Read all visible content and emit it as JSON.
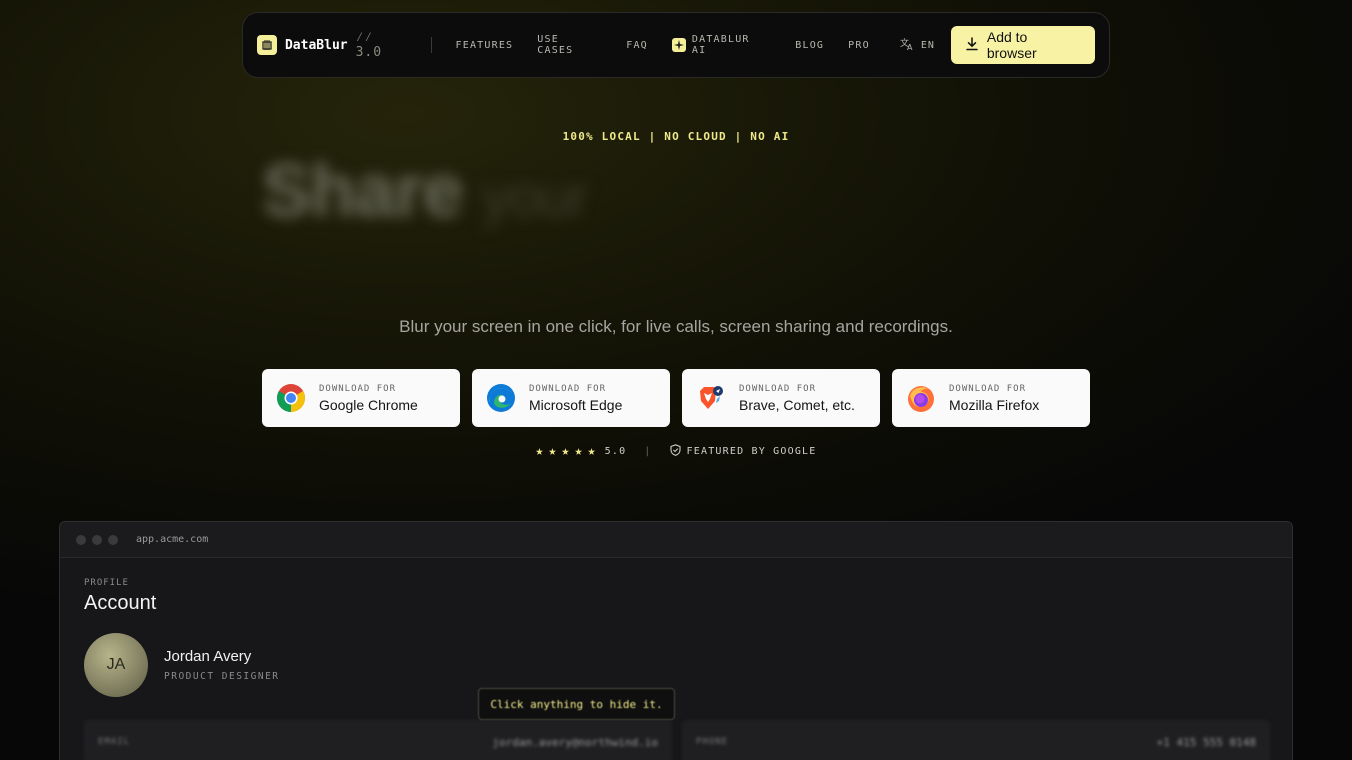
{
  "nav": {
    "brand": "DataBlur",
    "version": "⁄⁄ 3.0",
    "links": [
      {
        "label": "FEATURES"
      },
      {
        "label": "USE CASES"
      },
      {
        "label": "FAQ"
      },
      {
        "label": "DATABLUR AI"
      },
      {
        "label": "BLOG"
      },
      {
        "label": "PRO"
      }
    ],
    "language": "EN",
    "cta": "Add to browser"
  },
  "hero": {
    "tagline": "100% LOCAL | NO CLOUD | NO AI",
    "title_main": "Share",
    "title_rest": "your",
    "subtitle": "Blur your screen in one click, for live calls, screen sharing and recordings."
  },
  "downloads": [
    {
      "pre": "DOWNLOAD FOR",
      "name": "Google Chrome",
      "icon": "chrome-icon"
    },
    {
      "pre": "DOWNLOAD FOR",
      "name": "Microsoft Edge",
      "icon": "edge-icon"
    },
    {
      "pre": "DOWNLOAD FOR",
      "name": "Brave, Comet, etc.",
      "icon": "brave-icon"
    },
    {
      "pre": "DOWNLOAD FOR",
      "name": "Mozilla Firefox",
      "icon": "firefox-icon"
    }
  ],
  "rating": {
    "stars": 5,
    "score": "5.0",
    "featured": "FEATURED BY GOOGLE"
  },
  "mock": {
    "url": "app.acme.com",
    "section_label": "PROFILE",
    "title": "Account",
    "avatar_initials": "JA",
    "name": "Jordan Avery",
    "role": "PRODUCT DESIGNER",
    "fields": [
      {
        "label": "EMAIL",
        "value": "jordan.avery@northwind.io"
      },
      {
        "label": "PHONE",
        "value": "+1 415 555 0148"
      }
    ],
    "tooltip": "Click anything to hide it."
  },
  "colors": {
    "accent": "#f8f3a4",
    "tagline": "#f0e98a",
    "background": "#111106"
  }
}
